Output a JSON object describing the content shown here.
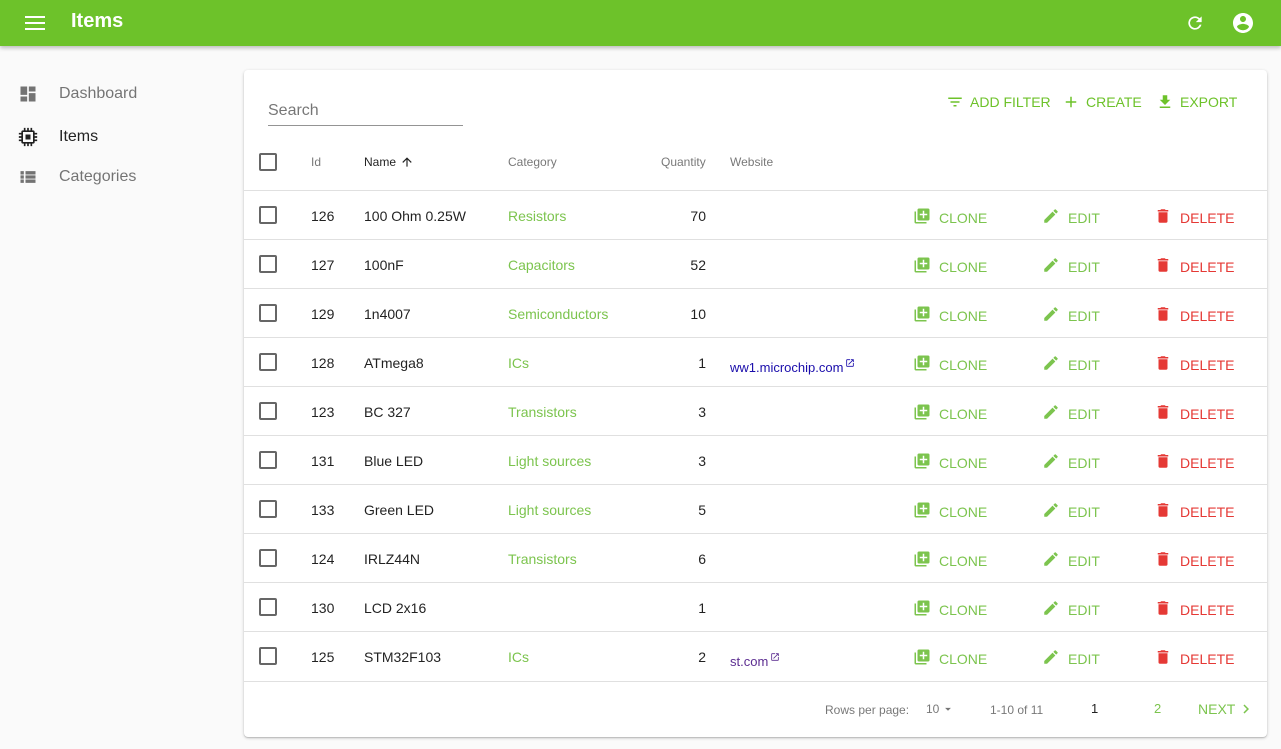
{
  "app": {
    "title": "Items",
    "accent": "#6dc22a",
    "delete_color": "#e53935"
  },
  "topbar": {
    "menu_icon": "menu-icon",
    "refresh_icon": "refresh-icon",
    "account_icon": "account-circle-icon"
  },
  "sidebar": {
    "items": [
      {
        "label": "Dashboard",
        "icon": "dashboard-icon",
        "active": false
      },
      {
        "label": "Items",
        "icon": "chip-icon",
        "active": true
      },
      {
        "label": "Categories",
        "icon": "list-icon",
        "active": false
      }
    ]
  },
  "toolbar": {
    "search_placeholder": "Search",
    "add_filter": "ADD FILTER",
    "create": "CREATE",
    "export": "EXPORT"
  },
  "table": {
    "headers": {
      "id": "Id",
      "name": "Name",
      "category": "Category",
      "quantity": "Quantity",
      "website": "Website"
    },
    "sort": {
      "column": "name",
      "direction": "ascending"
    },
    "actions": {
      "clone": "CLONE",
      "edit": "EDIT",
      "delete": "DELETE"
    },
    "rows": [
      {
        "id": "126",
        "name": "100 Ohm 0.25W",
        "category": "Resistors",
        "quantity": "70",
        "website": ""
      },
      {
        "id": "127",
        "name": "100nF",
        "category": "Capacitors",
        "quantity": "52",
        "website": ""
      },
      {
        "id": "129",
        "name": "1n4007",
        "category": "Semiconductors",
        "quantity": "10",
        "website": ""
      },
      {
        "id": "128",
        "name": "ATmega8",
        "category": "ICs",
        "quantity": "1",
        "website": "ww1.microchip.com"
      },
      {
        "id": "123",
        "name": "BC 327",
        "category": "Transistors",
        "quantity": "3",
        "website": ""
      },
      {
        "id": "131",
        "name": "Blue LED",
        "category": "Light sources",
        "quantity": "3",
        "website": ""
      },
      {
        "id": "133",
        "name": "Green LED",
        "category": "Light sources",
        "quantity": "5",
        "website": ""
      },
      {
        "id": "124",
        "name": "IRLZ44N",
        "category": "Transistors",
        "quantity": "6",
        "website": ""
      },
      {
        "id": "130",
        "name": "LCD 2x16",
        "category": "",
        "quantity": "1",
        "website": ""
      },
      {
        "id": "125",
        "name": "STM32F103",
        "category": "ICs",
        "quantity": "2",
        "website": "st.com"
      }
    ]
  },
  "pagination": {
    "rows_per_page_label": "Rows per page:",
    "rows_per_page": "10",
    "range": "1-10 of 11",
    "pages": [
      "1",
      "2"
    ],
    "current_page": "1",
    "next": "NEXT"
  }
}
